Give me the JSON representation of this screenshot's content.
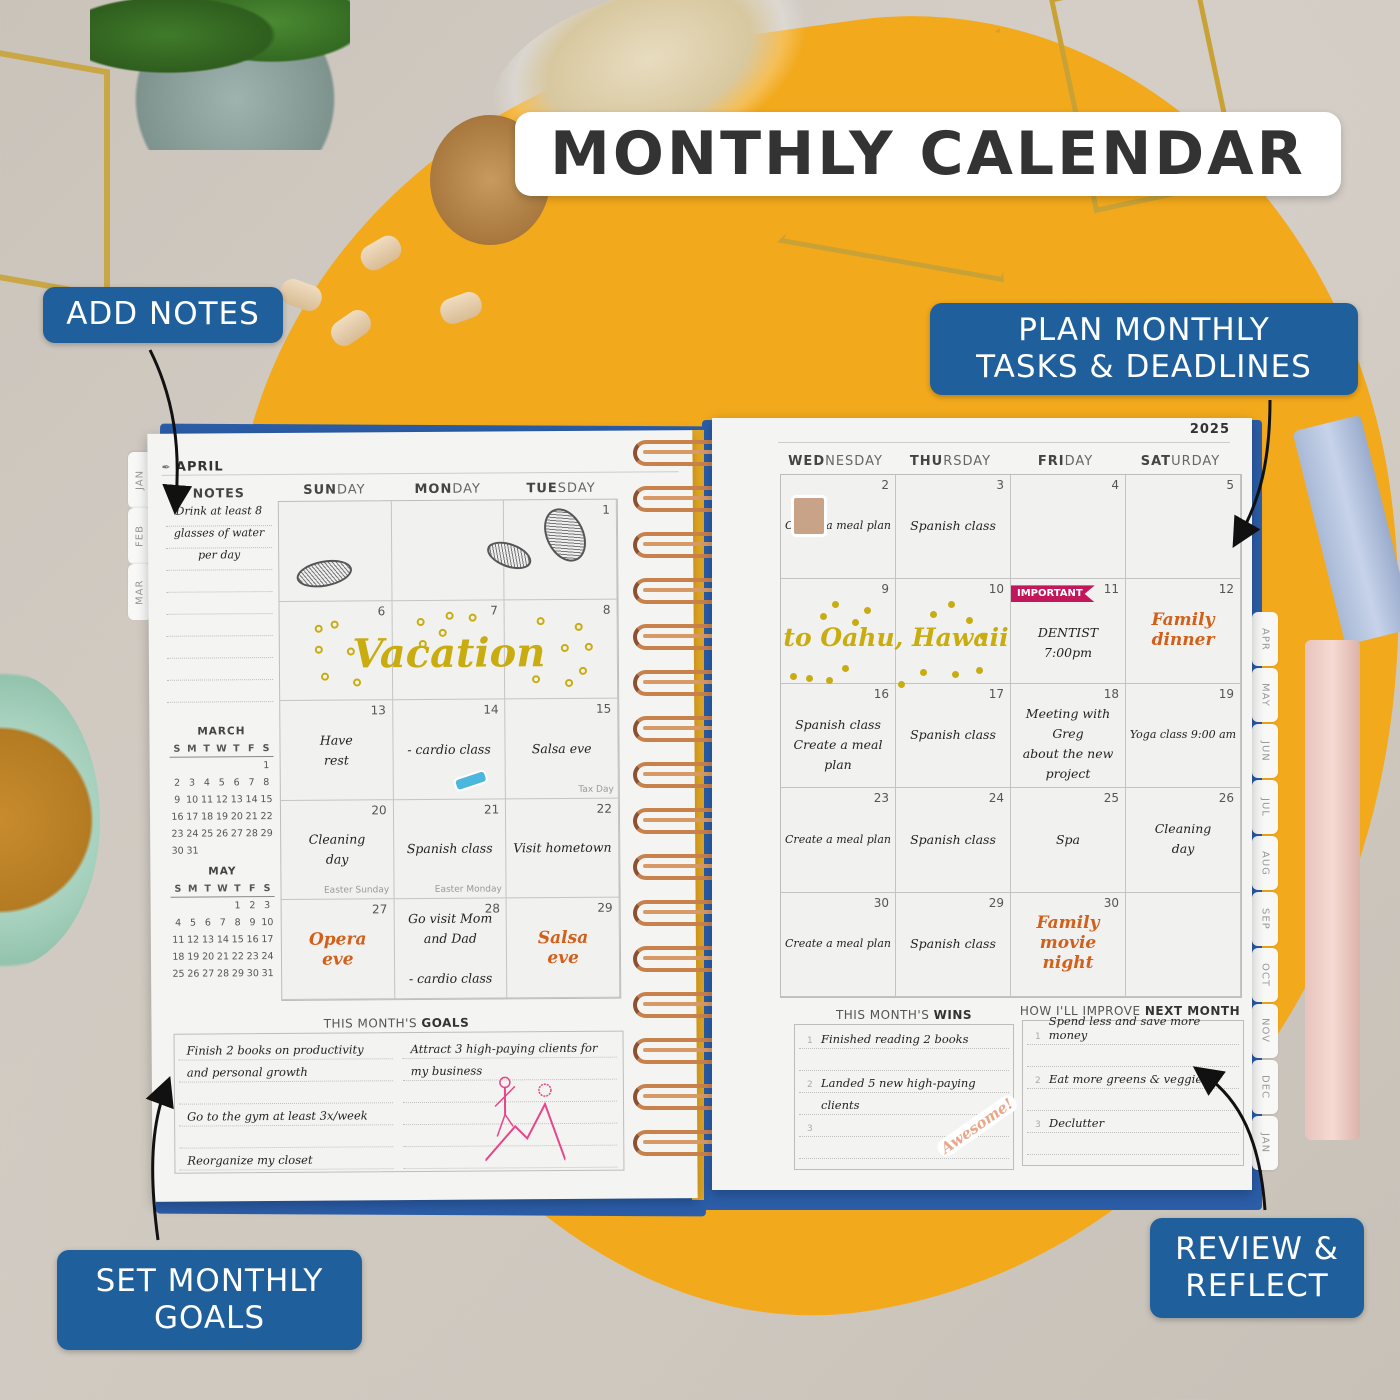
{
  "title": "MONTHLY CALENDAR",
  "callouts": {
    "add_notes": "ADD NOTES",
    "plan_monthly_line1": "PLAN MONTHLY",
    "plan_monthly_line2": "TASKS & DEADLINES",
    "set_goals_line1": "SET MONTHLY",
    "set_goals_line2": "GOALS",
    "review_line1": "REVIEW &",
    "review_line2": "REFLECT"
  },
  "colors": {
    "callout_blue": "#1e5f9c",
    "mat_yellow": "#f2a91c",
    "cover_blue": "#2b5da8",
    "script_gold": "#c8ac10",
    "script_orange": "#d3601a",
    "important_red": "#c2185b"
  },
  "planner": {
    "month": "APRIL",
    "year": "2025",
    "left_tabs": [
      "JAN",
      "FEB",
      "MAR"
    ],
    "right_tabs": [
      "APR",
      "MAY",
      "JUN",
      "JUL",
      "AUG",
      "SEP",
      "OCT",
      "NOV",
      "DEC",
      "JAN"
    ],
    "notes": {
      "header": "NOTES",
      "lines": [
        "Drink at least 8",
        "glasses of water",
        "per day"
      ]
    },
    "mini_calendars": [
      {
        "title": "MARCH",
        "weekdays": [
          "S",
          "M",
          "T",
          "W",
          "T",
          "F",
          "S"
        ],
        "weeks": [
          [
            "",
            "",
            "",
            "",
            "",
            "",
            "1"
          ],
          [
            "2",
            "3",
            "4",
            "5",
            "6",
            "7",
            "8"
          ],
          [
            "9",
            "10",
            "11",
            "12",
            "13",
            "14",
            "15"
          ],
          [
            "16",
            "17",
            "18",
            "19",
            "20",
            "21",
            "22"
          ],
          [
            "23",
            "24",
            "25",
            "26",
            "27",
            "28",
            "29"
          ],
          [
            "30",
            "31",
            "",
            "",
            "",
            "",
            ""
          ]
        ]
      },
      {
        "title": "MAY",
        "weekdays": [
          "S",
          "M",
          "T",
          "W",
          "T",
          "F",
          "S"
        ],
        "weeks": [
          [
            "",
            "",
            "",
            "",
            "1",
            "2",
            "3"
          ],
          [
            "4",
            "5",
            "6",
            "7",
            "8",
            "9",
            "10"
          ],
          [
            "11",
            "12",
            "13",
            "14",
            "15",
            "16",
            "17"
          ],
          [
            "18",
            "19",
            "20",
            "21",
            "22",
            "23",
            "24"
          ],
          [
            "25",
            "26",
            "27",
            "28",
            "29",
            "30",
            "31"
          ]
        ]
      }
    ],
    "left_days": [
      {
        "bold": "SUN",
        "rest": "DAY"
      },
      {
        "bold": "MON",
        "rest": "DAY"
      },
      {
        "bold": "TUE",
        "rest": "SDAY"
      }
    ],
    "right_days": [
      {
        "bold": "WED",
        "rest": "NESDAY"
      },
      {
        "bold": "THU",
        "rest": "RSDAY"
      },
      {
        "bold": "FRI",
        "rest": "DAY"
      },
      {
        "bold": "SAT",
        "rest": "URDAY"
      }
    ],
    "left_cells": [
      [
        {
          "num": "",
          "note": ""
        },
        {
          "num": "",
          "note": ""
        },
        {
          "num": "1",
          "note": ""
        }
      ],
      [
        {
          "num": "6",
          "note": ""
        },
        {
          "num": "7",
          "note": ""
        },
        {
          "num": "8",
          "note": ""
        }
      ],
      [
        {
          "num": "13",
          "note": "Have\nrest"
        },
        {
          "num": "14",
          "note": "- cardio class"
        },
        {
          "num": "15",
          "note": "Salsa eve",
          "holiday": "Tax Day"
        }
      ],
      [
        {
          "num": "20",
          "note": "Cleaning\nday",
          "holiday": "Easter Sunday"
        },
        {
          "num": "21",
          "note": "Spanish class",
          "holiday": "Easter Monday"
        },
        {
          "num": "22",
          "note": "Visit hometown"
        }
      ],
      [
        {
          "num": "27",
          "note": "Opera\neve",
          "style": "orange"
        },
        {
          "num": "28",
          "note": "Go visit Mom\nand Dad\n\n- cardio class"
        },
        {
          "num": "29",
          "note": "Salsa\neve",
          "style": "orange"
        }
      ]
    ],
    "vacation_text": "Vacation",
    "right_cells": [
      [
        {
          "num": "2",
          "note": "Create a meal plan"
        },
        {
          "num": "3",
          "note": "Spanish class"
        },
        {
          "num": "4",
          "note": ""
        },
        {
          "num": "5",
          "note": ""
        }
      ],
      [
        {
          "num": "9",
          "note": ""
        },
        {
          "num": "10",
          "note": ""
        },
        {
          "num": "11",
          "note": "DENTIST\n7:00pm",
          "flag": "IMPORTANT"
        },
        {
          "num": "12",
          "note": "Family\ndinner",
          "style": "orange"
        }
      ],
      [
        {
          "num": "16",
          "note": "Spanish class\nCreate a meal plan"
        },
        {
          "num": "17",
          "note": "Spanish class"
        },
        {
          "num": "18",
          "note": "Meeting with Greg\nabout the new\nproject"
        },
        {
          "num": "19",
          "note": "Yoga class 9:00 am"
        }
      ],
      [
        {
          "num": "23",
          "note": "Create a meal plan"
        },
        {
          "num": "24",
          "note": "Spanish class"
        },
        {
          "num": "25",
          "note": "Spa"
        },
        {
          "num": "26",
          "note": "Cleaning\nday"
        }
      ],
      [
        {
          "num": "30",
          "note": "Create a meal plan"
        },
        {
          "num": "29",
          "note": "Spanish class"
        },
        {
          "num": "30",
          "note": "Family\nmovie\nnight",
          "style": "orange"
        },
        {
          "num": "",
          "note": ""
        }
      ]
    ],
    "hawaii_text": "to Oahu, Hawaii",
    "goals": {
      "title_light": "THIS MONTH'S ",
      "title_bold": "GOALS",
      "left": [
        "Finish 2 books on productivity",
        "and personal growth",
        "",
        "Go to the gym at least 3x/week",
        "",
        "Reorganize my closet"
      ],
      "right": [
        "Attract 3 high-paying clients for",
        "my business",
        "",
        "",
        "",
        ""
      ]
    },
    "wins": {
      "title_light": "THIS MONTH'S ",
      "title_bold": "WINS",
      "rows": [
        {
          "idx": "1",
          "text": "Finished reading 2 books"
        },
        {
          "idx": "",
          "text": ""
        },
        {
          "idx": "2",
          "text": "Landed 5 new high-paying"
        },
        {
          "idx": "",
          "text": "clients"
        },
        {
          "idx": "3",
          "text": ""
        },
        {
          "idx": "",
          "text": ""
        }
      ],
      "sticker": "Awesome!"
    },
    "improve": {
      "title_light": "HOW I'LL IMPROVE ",
      "title_bold": "NEXT MONTH",
      "rows": [
        {
          "idx": "1",
          "text": "Spend less and save more money"
        },
        {
          "idx": "",
          "text": ""
        },
        {
          "idx": "2",
          "text": "Eat more greens & veggies"
        },
        {
          "idx": "",
          "text": ""
        },
        {
          "idx": "3",
          "text": "Declutter"
        },
        {
          "idx": "",
          "text": ""
        }
      ]
    }
  }
}
